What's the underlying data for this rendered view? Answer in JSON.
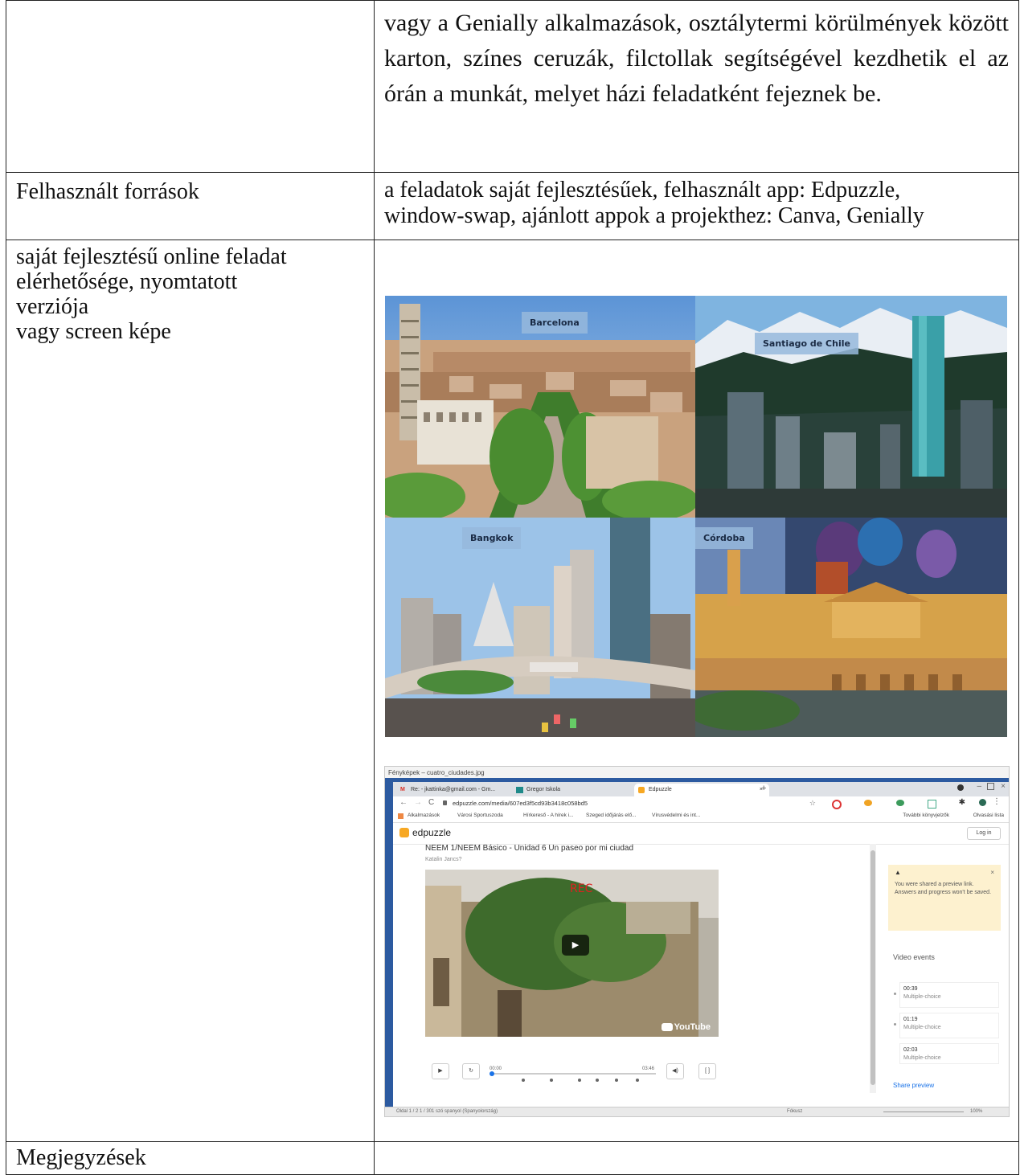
{
  "row1": {
    "right_text": "vagy a Genially alkalmazások, osztálytermi körülmények között karton, színes ceruzák, filctollak segítségével kezdhetik el az órán a munkát, melyet házi feladatként fejeznek be."
  },
  "row2": {
    "label": "Felhasznált források",
    "value_line1": "a feladatok saját fejlesztésűek, felhasznált app: Edpuzzle,",
    "value_line2": "window-swap, ajánlott appok a projekthez: Canva, Genially"
  },
  "row3": {
    "label_line1": "saját fejlesztésű online feladat",
    "label_line2": "elérhetősége, nyomtatott",
    "label_line3": "verziója",
    "label_line4": "vagy screen képe"
  },
  "collage": {
    "labels": [
      "Barcelona",
      "Santiago de Chile",
      "Bangkok",
      "Córdoba"
    ]
  },
  "screenshot": {
    "window_title": "Fényképek – cuatro_ciudades.jpg",
    "tabs": [
      "Re: - jkattinka@gmail.com - Gm...",
      "Gregor Iskola",
      "Edpuzzle"
    ],
    "tab_close": "×",
    "new_tab": "+",
    "url": "edpuzzle.com/media/607ed3f5cd93b3418c058bd5",
    "bookmarks": [
      "Alkalmazások",
      "Városi Sportuszoda",
      "Hírkereső - A hírek i...",
      "Szeged időjárás elő...",
      "Vírusvédelmi és int..."
    ],
    "bookmarks_right": [
      "További könyvjelzők",
      "Olvasási lista"
    ],
    "brand": "edpuzzle",
    "login": "Log in",
    "lesson_title": "NEEM 1/NEEM Básico - Unidad 6 Un paseo por mi ciudad",
    "author": "Katalin Jancs?",
    "rec": "REC",
    "youtube": "YouTube",
    "time_start": "00:00",
    "time_end": "03:46",
    "notice": "You were shared a preview link. Answers and progress won't be saved.",
    "events_title": "Video events",
    "events": [
      {
        "time": "00:39",
        "type": "Multiple-choice"
      },
      {
        "time": "01:19",
        "type": "Multiple-choice"
      },
      {
        "time": "02:03",
        "type": "Multiple-choice"
      }
    ],
    "share": "Share preview",
    "status_left": "Oldal 1 / 2    1 / 301 szó    spanyol (Spanyolország)",
    "status_focus": "Fókusz",
    "status_zoom": "100%"
  },
  "row4": {
    "label": "Megjegyzések"
  },
  "colors": {
    "border": "#222222",
    "edpuzzle_orange": "#f7a823",
    "notice_bg": "#fdf1cf",
    "link_blue": "#1a73e8"
  }
}
